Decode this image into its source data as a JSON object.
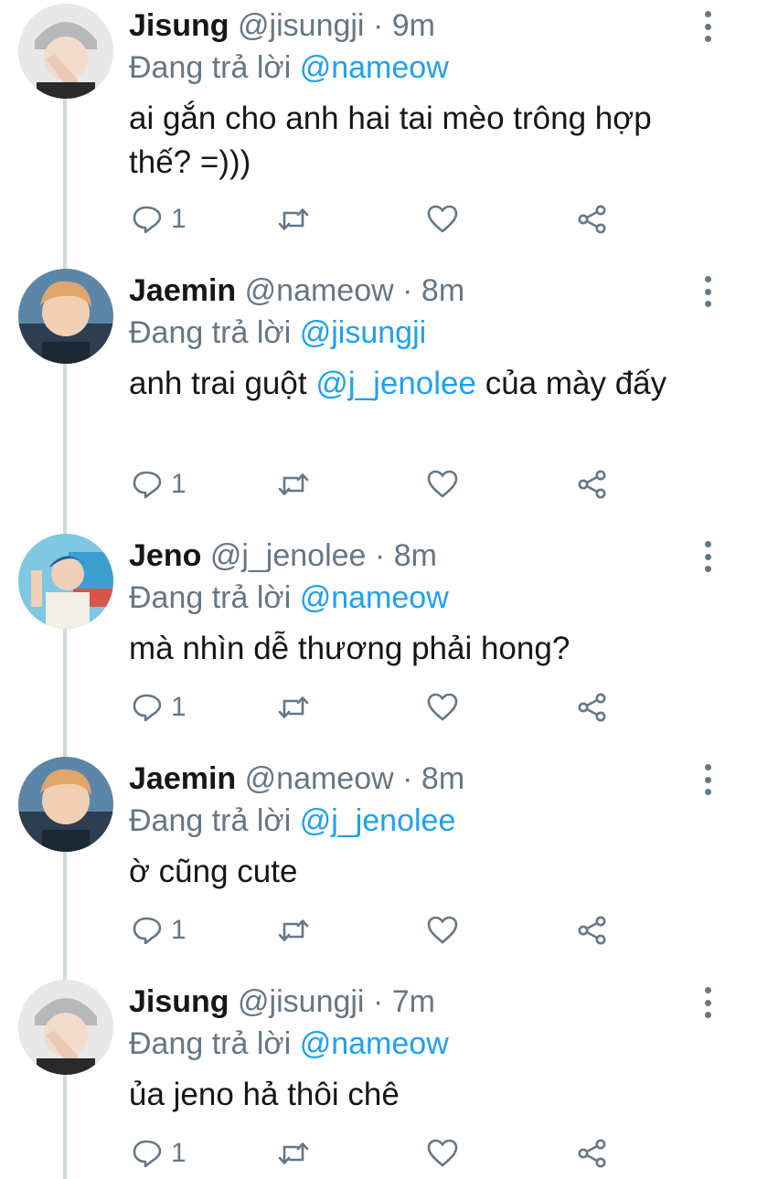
{
  "reply_prefix": "Đang trả lời",
  "tweets": [
    {
      "name": "Jisung",
      "handle": "@jisungji",
      "dot": "·",
      "time": "9m",
      "replying_to": "@nameow",
      "text_parts": [
        {
          "t": "ai gắn cho anh hai tai mèo trông hợp thế? =)))",
          "mention": false
        }
      ],
      "reply_count": "1",
      "avatar": "avatar-jisung"
    },
    {
      "name": "Jaemin",
      "handle": "@nameow",
      "dot": "·",
      "time": "8m",
      "replying_to": "@jisungji",
      "text_parts": [
        {
          "t": "anh trai guột ",
          "mention": false
        },
        {
          "t": "@j_jenolee",
          "mention": true
        },
        {
          "t": " của mày đấy",
          "mention": false
        }
      ],
      "reply_count": "1",
      "avatar": "avatar-jaemin"
    },
    {
      "name": "Jeno",
      "handle": "@j_jenolee",
      "dot": "·",
      "time": "8m",
      "replying_to": "@nameow",
      "text_parts": [
        {
          "t": "mà nhìn dễ thương phải hong?",
          "mention": false
        }
      ],
      "reply_count": "1",
      "avatar": "avatar-jeno"
    },
    {
      "name": "Jaemin",
      "handle": "@nameow",
      "dot": "·",
      "time": "8m",
      "replying_to": "@j_jenolee",
      "text_parts": [
        {
          "t": "ờ cũng cute",
          "mention": false
        }
      ],
      "reply_count": "1",
      "avatar": "avatar-jaemin"
    },
    {
      "name": "Jisung",
      "handle": "@jisungji",
      "dot": "·",
      "time": "7m",
      "replying_to": "@nameow",
      "text_parts": [
        {
          "t": "ủa jeno hả thôi chê",
          "mention": false
        }
      ],
      "reply_count": "1",
      "avatar": "avatar-jisung"
    }
  ],
  "icons": {
    "reply": "reply-icon",
    "retweet": "retweet-icon",
    "like": "heart-icon",
    "share": "share-icon",
    "more": "more-vertical-icon"
  },
  "colors": {
    "mention": "#1da1f2",
    "secondary": "#657786",
    "primary": "#14171a",
    "thread_line": "#cfd9de"
  }
}
